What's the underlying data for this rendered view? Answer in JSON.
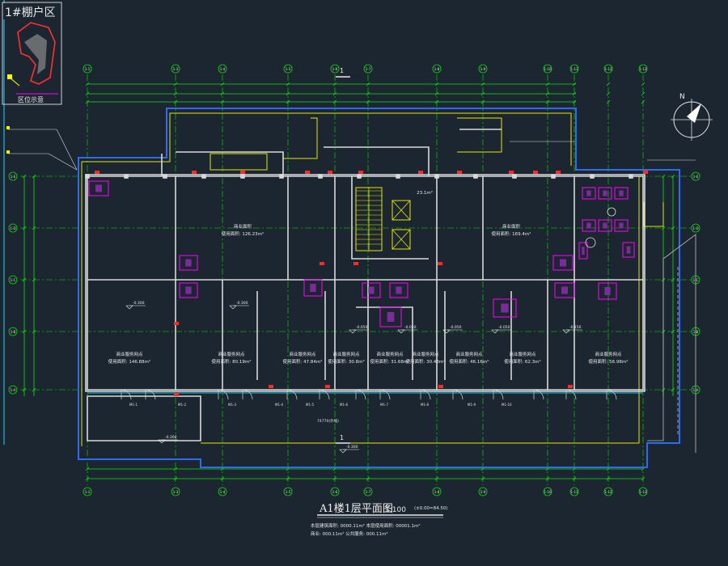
{
  "key_plan": {
    "title": "1#棚户区",
    "caption": "区位示意"
  },
  "plan": {
    "title": "A1楼1层平面图",
    "scale": "1:100",
    "elevation_tag": "(±0.00=84.50)",
    "section_mark": "1",
    "width_dim": "74770(外墙)",
    "area_stats": [
      "本层建筑面积: 0000.11m²  本层使用面积: 00001.1m²",
      "商业: 000.11m²  公共服务: 000.11m²"
    ]
  },
  "rooms": [
    {
      "id": "r1",
      "label": "商业面积",
      "area": "使用面积: 126.23m²"
    },
    {
      "id": "r2",
      "label": "商业面积",
      "area": "使用面积: 169.4m²"
    },
    {
      "id": "r3",
      "label": "",
      "area": "23.1m²"
    },
    {
      "id": "s1",
      "label": "商业服务网点",
      "area": "使用面积: 146.88m²"
    },
    {
      "id": "s2",
      "label": "商业服务网点",
      "area": "使用面积: 80.19m²"
    },
    {
      "id": "s3",
      "label": "商业服务网点",
      "area": "使用面积: 47.84m²"
    },
    {
      "id": "s4",
      "label": "商业服务网点",
      "area": "使用面积: 30.8m²"
    },
    {
      "id": "s5",
      "label": "商业服务网点",
      "area": "使用面积: 31.68m²"
    },
    {
      "id": "s6",
      "label": "商业服务网点",
      "area": "使用面积: 30.48m²"
    },
    {
      "id": "s7",
      "label": "商业服务网点",
      "area": "使用面积: 46.16m²"
    },
    {
      "id": "s8",
      "label": "商业服务网点",
      "area": "使用面积: 62.3m²"
    },
    {
      "id": "s9",
      "label": "商业服务网点",
      "area": "使用面积: 56.98m²"
    }
  ],
  "elevations": [
    "-0.300",
    "-0.300",
    "-0.050",
    "-0.050",
    "-0.050",
    "-0.050",
    "-0.150",
    "-0.300",
    "-0.300"
  ],
  "axis_top": [
    "1-1",
    "1-3",
    "1-4",
    "1-5",
    "1-6",
    "1-7",
    "1-8",
    "1-9",
    "1-10",
    "1-11",
    "1-12",
    "1-13"
  ],
  "axis_left": [
    "1-E",
    "1-D",
    "1-C",
    "1-B",
    "1-A"
  ],
  "doors": [
    "M1-1",
    "M1-2",
    "M1-3",
    "M1-4",
    "M1-5",
    "M1-6",
    "M1-7",
    "M1-8",
    "M1-9",
    "M1-10"
  ],
  "colors": {
    "background": "#1c2630",
    "wall": "#d9d9d9",
    "boundary": "#2d6cf0",
    "axis": "#00e400",
    "dim": "#0ee00e",
    "accent": "#ffff00",
    "fixture": "#ff00ff",
    "door": "#ff3b3b"
  }
}
